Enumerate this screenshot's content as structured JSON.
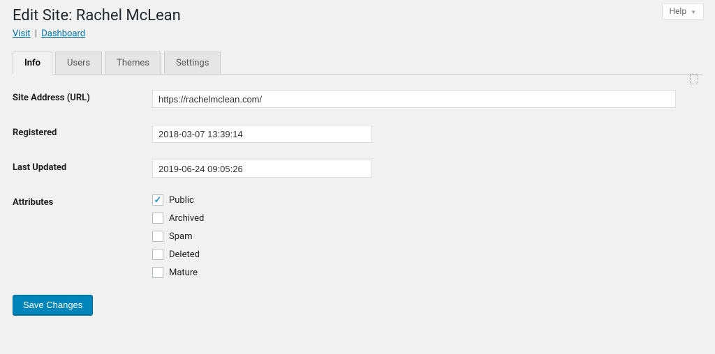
{
  "help_label": "Help",
  "page_title": "Edit Site: Rachel McLean",
  "sublinks": {
    "visit": "Visit",
    "dashboard": "Dashboard"
  },
  "tabs": [
    "Info",
    "Users",
    "Themes",
    "Settings"
  ],
  "active_tab_index": 0,
  "fields": {
    "site_address": {
      "label": "Site Address (URL)",
      "value": "https://rachelmclean.com/"
    },
    "registered": {
      "label": "Registered",
      "value": "2018-03-07 13:39:14"
    },
    "last_updated": {
      "label": "Last Updated",
      "value": "2019-06-24 09:05:26"
    },
    "attributes_label": "Attributes"
  },
  "attributes": [
    {
      "label": "Public",
      "checked": true
    },
    {
      "label": "Archived",
      "checked": false
    },
    {
      "label": "Spam",
      "checked": false
    },
    {
      "label": "Deleted",
      "checked": false
    },
    {
      "label": "Mature",
      "checked": false
    }
  ],
  "save_label": "Save Changes"
}
